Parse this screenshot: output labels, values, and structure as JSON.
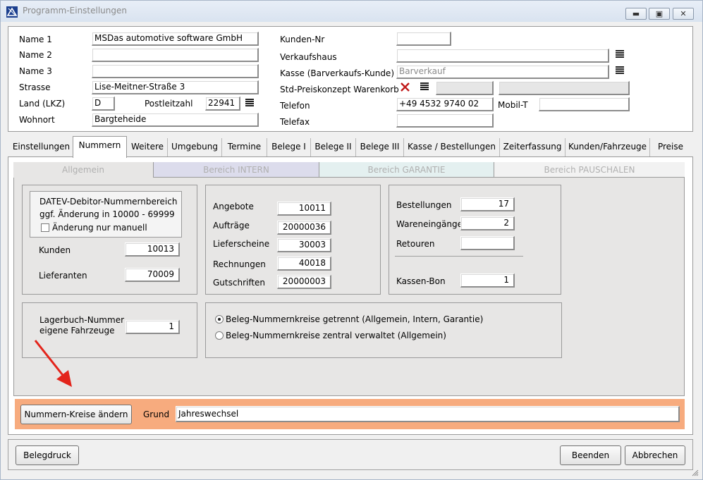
{
  "window": {
    "title": "Programm-Einstellungen",
    "min_icon": "minimize-icon",
    "max_icon": "maximize-icon",
    "close_icon": "close-icon"
  },
  "company": {
    "name1_label": "Name 1",
    "name1_value": "MSDas automotive software GmbH",
    "name2_label": "Name 2",
    "name2_value": "",
    "name3_label": "Name 3",
    "name3_value": "",
    "strasse_label": "Strasse",
    "strasse_value": "Lise-Meitner-Straße 3",
    "land_label": "Land (LKZ)",
    "land_value": "D",
    "plz_label": "Postleitzahl",
    "plz_value": "22941",
    "wohnort_label": "Wohnort",
    "wohnort_value": "Bargteheide"
  },
  "customer": {
    "kundennr_label": "Kunden-Nr",
    "kundennr_value": "",
    "verkaufshaus_label": "Verkaufshaus",
    "verkaufshaus_value": "",
    "kasse_label": "Kasse (Barverkaufs-Kunde)",
    "kasse_placeholder": "Barverkauf",
    "preiskonzept_label": "Std-Preiskonzept Warenkorb",
    "telefon_label": "Telefon",
    "telefon_value": "+49 4532 9740 02",
    "mobil_label": "Mobil-T",
    "mobil_value": "",
    "telefax_label": "Telefax",
    "telefax_value": ""
  },
  "tabs": [
    "Einstellungen",
    "Nummern",
    "Weitere",
    "Umgebung",
    "Termine",
    "Belege I",
    "Belege II",
    "Belege III",
    "Kasse / Bestellungen",
    "Zeiterfassung",
    "Kunden/Fahrzeuge",
    "Preise"
  ],
  "active_tab": "Nummern",
  "subtabs": [
    "Allgemein",
    "Bereich INTERN",
    "Bereich GARANTIE",
    "Bereich PAUSCHALEN"
  ],
  "datev": {
    "line1": "DATEV-Debitor-Nummernbereich",
    "line2": "ggf. Änderung in 10000 - 69999",
    "checkbox_label": "Änderung nur manuell",
    "kunden_label": "Kunden",
    "kunden_value": "10013",
    "lieferanten_label": "Lieferanten",
    "lieferanten_value": "70009"
  },
  "belege": {
    "angebote_label": "Angebote",
    "angebote_value": "10011",
    "auftraege_label": "Aufträge",
    "auftraege_value": "20000036",
    "lieferscheine_label": "Lieferscheine",
    "lieferscheine_value": "30003",
    "rechnungen_label": "Rechnungen",
    "rechnungen_value": "40018",
    "gutschriften_label": "Gutschriften",
    "gutschriften_value": "20000003"
  },
  "bestellungen": {
    "bestellungen_label": "Bestellungen",
    "bestellungen_value": "17",
    "wareneingaenge_label": "Wareneingänge",
    "wareneingaenge_value": "2",
    "retouren_label": "Retouren",
    "retouren_value": "",
    "kassenbon_label": "Kassen-Bon",
    "kassenbon_value": "1"
  },
  "lagerbuch": {
    "line1": "Lagerbuch-Nummer",
    "line2": "eigene Fahrzeuge",
    "value": "1"
  },
  "nummernkreise": {
    "option1": "Beleg-Nummernkreise getrennt (Allgemein, Intern, Garantie)",
    "option2": "Beleg-Nummernkreise zentral verwaltet (Allgemein)",
    "selected": 1
  },
  "change": {
    "button_label": "Nummern-Kreise ändern",
    "grund_label": "Grund",
    "grund_value": "Jahreswechsel"
  },
  "footer": {
    "belegdruck_label": "Belegdruck",
    "beenden_label": "Beenden",
    "abbrechen_label": "Abbrechen"
  },
  "colors": {
    "highlight": "#f7ab7e",
    "arrow": "#e3241b",
    "clear_x": "#c01818"
  }
}
